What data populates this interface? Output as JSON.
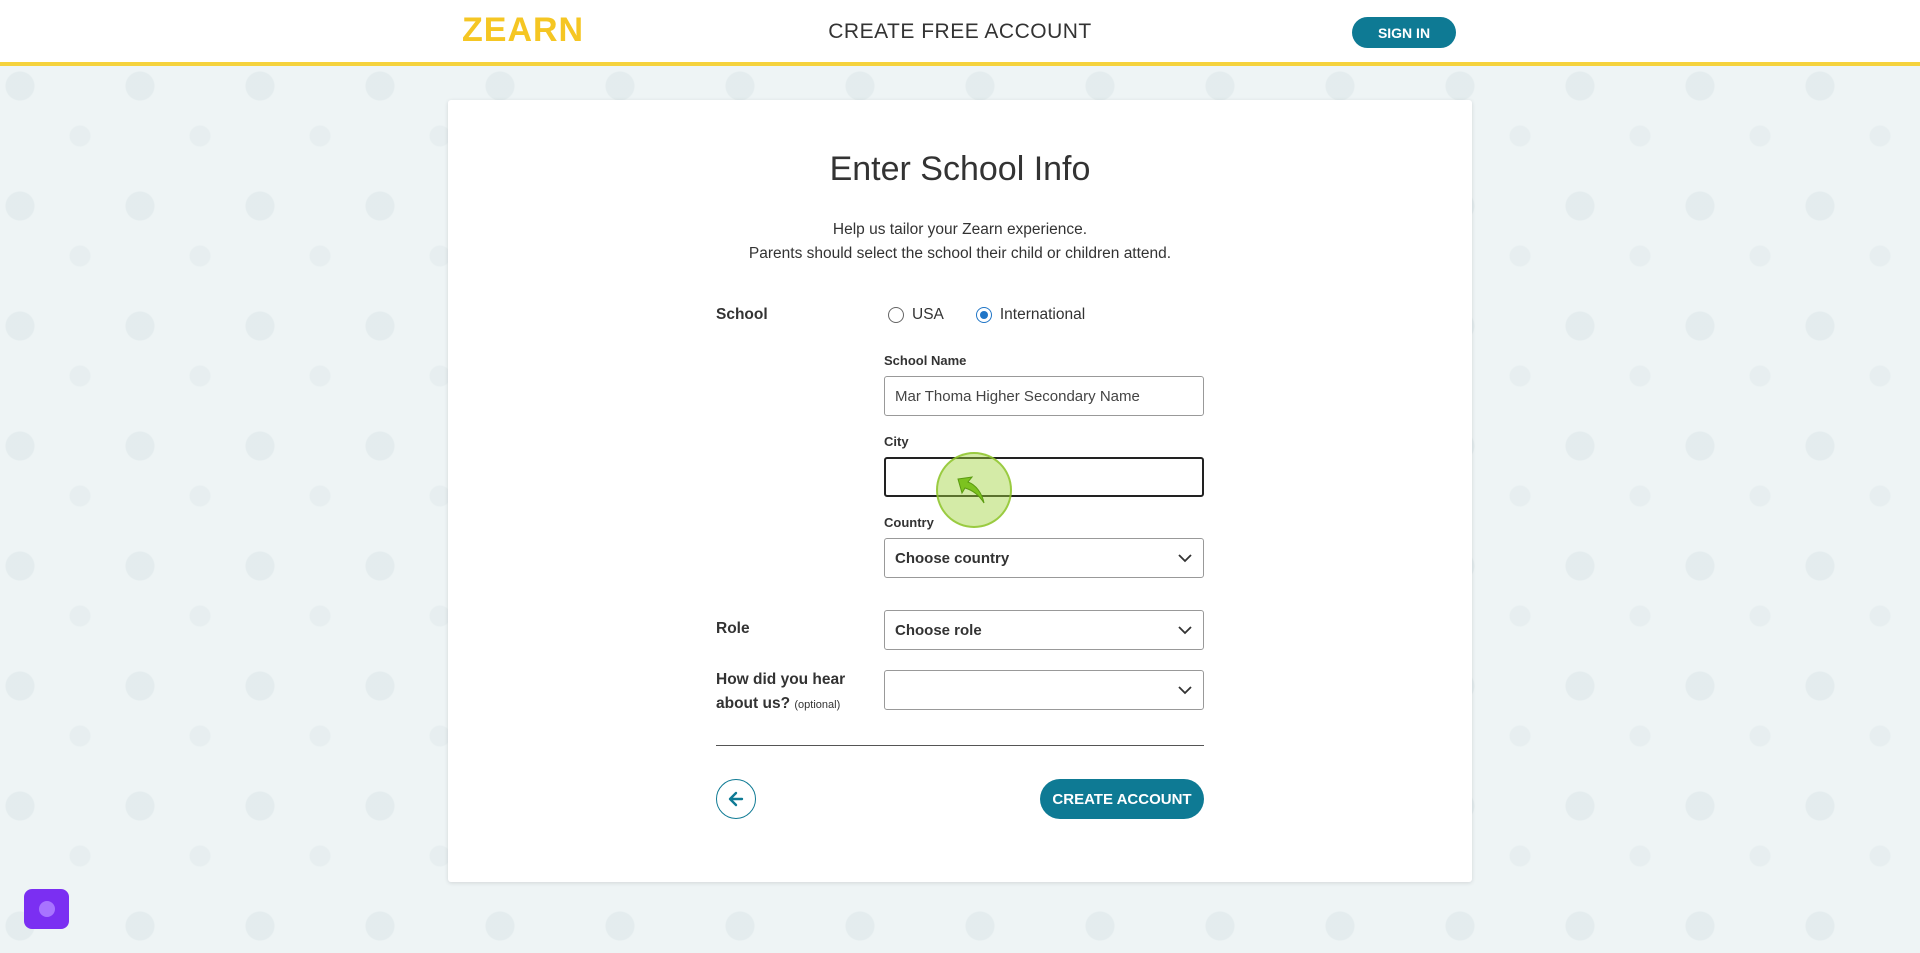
{
  "header": {
    "logo_text": "ZEARN",
    "title": "CREATE FREE ACCOUNT",
    "sign_in_label": "SIGN IN"
  },
  "card": {
    "title": "Enter School Info",
    "subtitle_line1": "Help us tailor your Zearn experience.",
    "subtitle_line2": "Parents should select the school their child or children attend."
  },
  "school": {
    "label": "School",
    "options": [
      {
        "label": "USA",
        "checked": false
      },
      {
        "label": "International",
        "checked": true
      }
    ],
    "school_name_label": "School Name",
    "school_name_value": "Mar Thoma Higher Secondary Name",
    "city_label": "City",
    "city_value": "",
    "country_label": "Country",
    "country_value": "Choose country"
  },
  "role": {
    "label": "Role",
    "value": "Choose role"
  },
  "hear": {
    "label_line1": "How did you hear",
    "label_line2": "about us?",
    "optional": "(optional)",
    "value": ""
  },
  "actions": {
    "create_account_label": "CREATE ACCOUNT"
  },
  "colors": {
    "brand_teal": "#0e7a94",
    "brand_yellow": "#f5d23c",
    "logo_yellow": "#f5c623",
    "chat_purple": "#7b2ff2"
  },
  "icons": {
    "back": "arrow-left-icon",
    "dropdown": "chevron-down-icon",
    "chat": "chat-icon"
  }
}
